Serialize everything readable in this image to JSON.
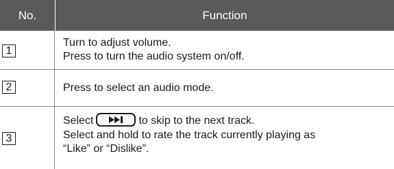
{
  "header": {
    "no_label": "No.",
    "function_label": "Function"
  },
  "rows": [
    {
      "number": "1",
      "lines": [
        "Turn to adjust volume.",
        "Press to turn the audio system on/off."
      ]
    },
    {
      "number": "2",
      "lines": [
        "Press to select an audio mode."
      ]
    },
    {
      "number": "3",
      "line1_before": "Select",
      "line1_after": "to skip to the next track.",
      "line2": "Select and hold to rate the track currently playing as",
      "line3": "“Like” or “Dislike”.",
      "button_icon": "skip-next-icon"
    }
  ],
  "colors": {
    "header_bg": "#5a5a5a",
    "header_text": "#ffffff",
    "rule": "#8a8a8a",
    "text": "#1a1a1a"
  }
}
